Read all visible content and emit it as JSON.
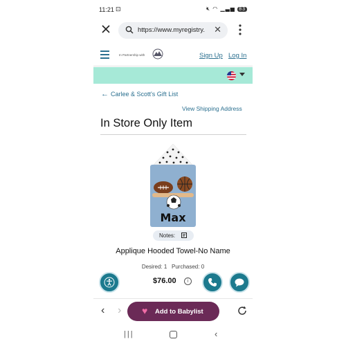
{
  "status_bar": {
    "time": "11:21",
    "battery": "83"
  },
  "browser": {
    "url": "https://www.myregistry.",
    "close_icon": "close-icon",
    "more_icon": "more-vert-icon"
  },
  "site_header": {
    "partner_text": "In Partnership with",
    "sign_up": "Sign Up",
    "log_in": "Log In"
  },
  "main": {
    "back_link": "Carlee & Scott's Gift List",
    "shipping_link": "View Shipping Address",
    "title": "In Store Only Item",
    "towel_name_text": "Max",
    "notes_label": "Notes:",
    "product_name": "Applique Hooded Towel-No Name",
    "desired": "Desired: 1",
    "purchased": "Purchased: 0",
    "price": "$76.00"
  },
  "bottom_bar": {
    "babylist_label": "Add to Babylist"
  },
  "colors": {
    "accent": "#2a6f8f",
    "mint": "#a6e9d7",
    "babylist": "#6b2a57",
    "fab": "#1c7a8e"
  }
}
